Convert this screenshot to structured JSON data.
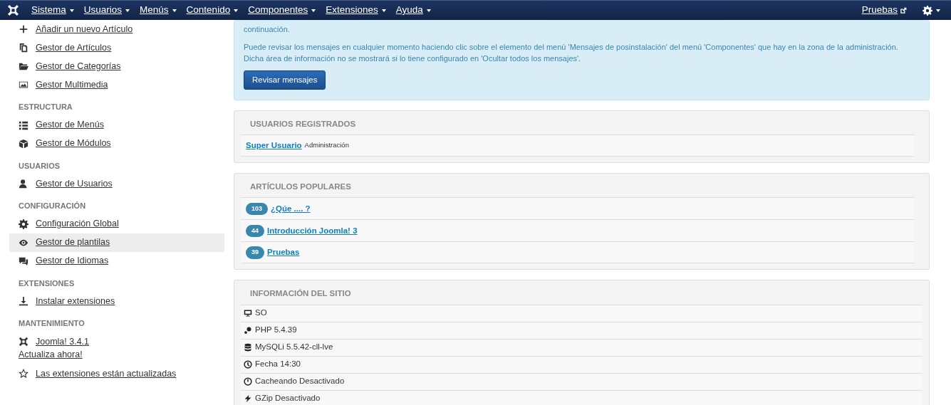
{
  "navbar": {
    "menus": [
      {
        "label": "Sistema"
      },
      {
        "label": "Usuarios"
      },
      {
        "label": "Menús"
      },
      {
        "label": "Contenido"
      },
      {
        "label": "Componentes"
      },
      {
        "label": "Extensiones"
      },
      {
        "label": "Ayuda"
      }
    ],
    "site_link": "Pruebas"
  },
  "sidebar": {
    "sections": [
      {
        "items": [
          {
            "label": "Añadir un nuevo Artículo",
            "selected": false
          },
          {
            "label": "Gestor de Artículos",
            "selected": false
          },
          {
            "label": "Gestor de Categorías",
            "selected": false
          },
          {
            "label": "Gestor Multimedia",
            "selected": false
          }
        ]
      },
      {
        "heading": "ESTRUCTURA",
        "items": [
          {
            "label": "Gestor de Menús",
            "selected": false
          },
          {
            "label": "Gestor de Módulos",
            "selected": false
          }
        ]
      },
      {
        "heading": "USUARIOS",
        "items": [
          {
            "label": "Gestor de Usuarios",
            "selected": false
          }
        ]
      },
      {
        "heading": "CONFIGURACIÓN",
        "items": [
          {
            "label": "Configuración Global",
            "selected": false
          },
          {
            "label": "Gestor de plantilas",
            "selected": true
          },
          {
            "label": "Gestor de Idiomas",
            "selected": false
          }
        ]
      },
      {
        "heading": "EXTENSIONES",
        "items": [
          {
            "label": "Instalar extensiones",
            "selected": false
          }
        ]
      },
      {
        "heading": "MANTENIMIENTO",
        "items": [
          {
            "label": "Joomla! 3.4.1",
            "note": "Actualiza ahora!",
            "selected": false
          },
          {
            "label": "Las extensiones están actualizadas",
            "selected": false
          }
        ]
      }
    ]
  },
  "message": {
    "paragraphs": [
      "continuación.",
      "Puede revisar los mensajes en cualquier momento haciendo clic sobre el elemento del menú 'Mensajes de posinstalación' del menú 'Componentes' que hay en la zona de la administración. Dicha área de información no se mostrará si lo tiene configurado en 'Ocultar todos los mensajes'."
    ],
    "button": "Revisar mensajes"
  },
  "registered_users": {
    "title": "USUARIOS REGISTRADOS",
    "users": [
      {
        "name": "Super Usuario",
        "role": "Administración"
      }
    ]
  },
  "popular_articles": {
    "title": "ARTÍCULOS POPULARES",
    "articles": [
      {
        "hits": "103",
        "title": "¿Qúe .... ?"
      },
      {
        "hits": "44",
        "title": "Introducción Joomla! 3"
      },
      {
        "hits": "39",
        "title": "Pruebas"
      }
    ]
  },
  "site_info": {
    "title": "INFORMACIÓN DEL SITIO",
    "rows": [
      "SO",
      "PHP 5.4.39",
      "MySQLi 5.5.42-cll-lve",
      "Fecha 14:30",
      "Cacheando Desactivado",
      "GZip Desactivado"
    ]
  }
}
